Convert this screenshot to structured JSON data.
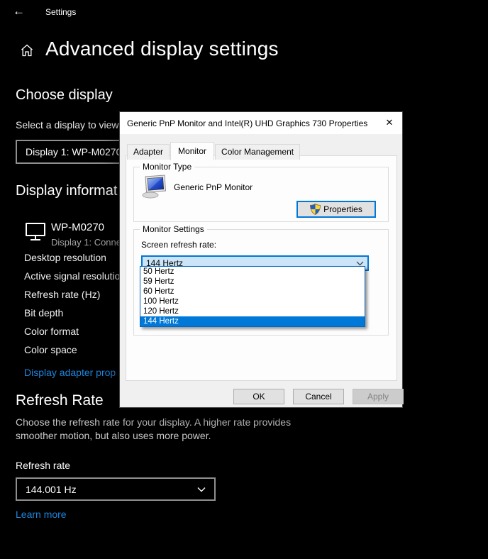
{
  "colors": {
    "accent_blue": "#0078d7",
    "link_blue": "#1e84de",
    "selection_blue": "#0078d7",
    "page_background": "#000000",
    "dialog_background": "#f0f0f0"
  },
  "titlebar": {
    "back_icon": "←",
    "app_title": "Settings"
  },
  "page": {
    "title": "Advanced display settings",
    "choose_display": {
      "heading": "Choose display",
      "subtext": "Select a display to view",
      "display_select_value": "Display 1: WP-M0270"
    },
    "display_information": {
      "heading": "Display informat",
      "monitor_name": "WP-M0270",
      "monitor_status": "Display 1: Conne",
      "rows": [
        "Desktop resolution",
        "Active signal resolutio",
        "Refresh rate (Hz)",
        "Bit depth",
        "Color format",
        "Color space"
      ],
      "adapter_link": "Display adapter prop"
    },
    "refresh_rate": {
      "heading": "Refresh Rate",
      "description_line1": "Choose the refresh rate for your display. A higher rate provides",
      "description_line2": "smoother motion, but also uses more power.",
      "field_label": "Refresh rate",
      "select_value": "144.001 Hz",
      "learn_more_link": "Learn more"
    }
  },
  "dialog": {
    "title": "Generic PnP Monitor and Intel(R) UHD Graphics 730 Properties",
    "close_icon": "✕",
    "tabs": [
      {
        "label": "Adapter"
      },
      {
        "label": "Monitor"
      },
      {
        "label": "Color Management"
      }
    ],
    "active_tab": "Monitor",
    "monitor_type": {
      "legend": "Monitor Type",
      "monitor_name": "Generic PnP Monitor",
      "properties_button": "Properties"
    },
    "monitor_settings": {
      "legend": "Monitor Settings",
      "field_label": "Screen refresh rate:",
      "combobox_value": "144 Hertz",
      "options": [
        "50 Hertz",
        "59 Hertz",
        "60 Hertz",
        "100 Hertz",
        "120 Hertz",
        "144 Hertz"
      ],
      "selected_option": "144 Hertz"
    },
    "action_buttons": {
      "ok": "OK",
      "cancel": "Cancel",
      "apply": "Apply"
    },
    "apply_disabled": true
  }
}
